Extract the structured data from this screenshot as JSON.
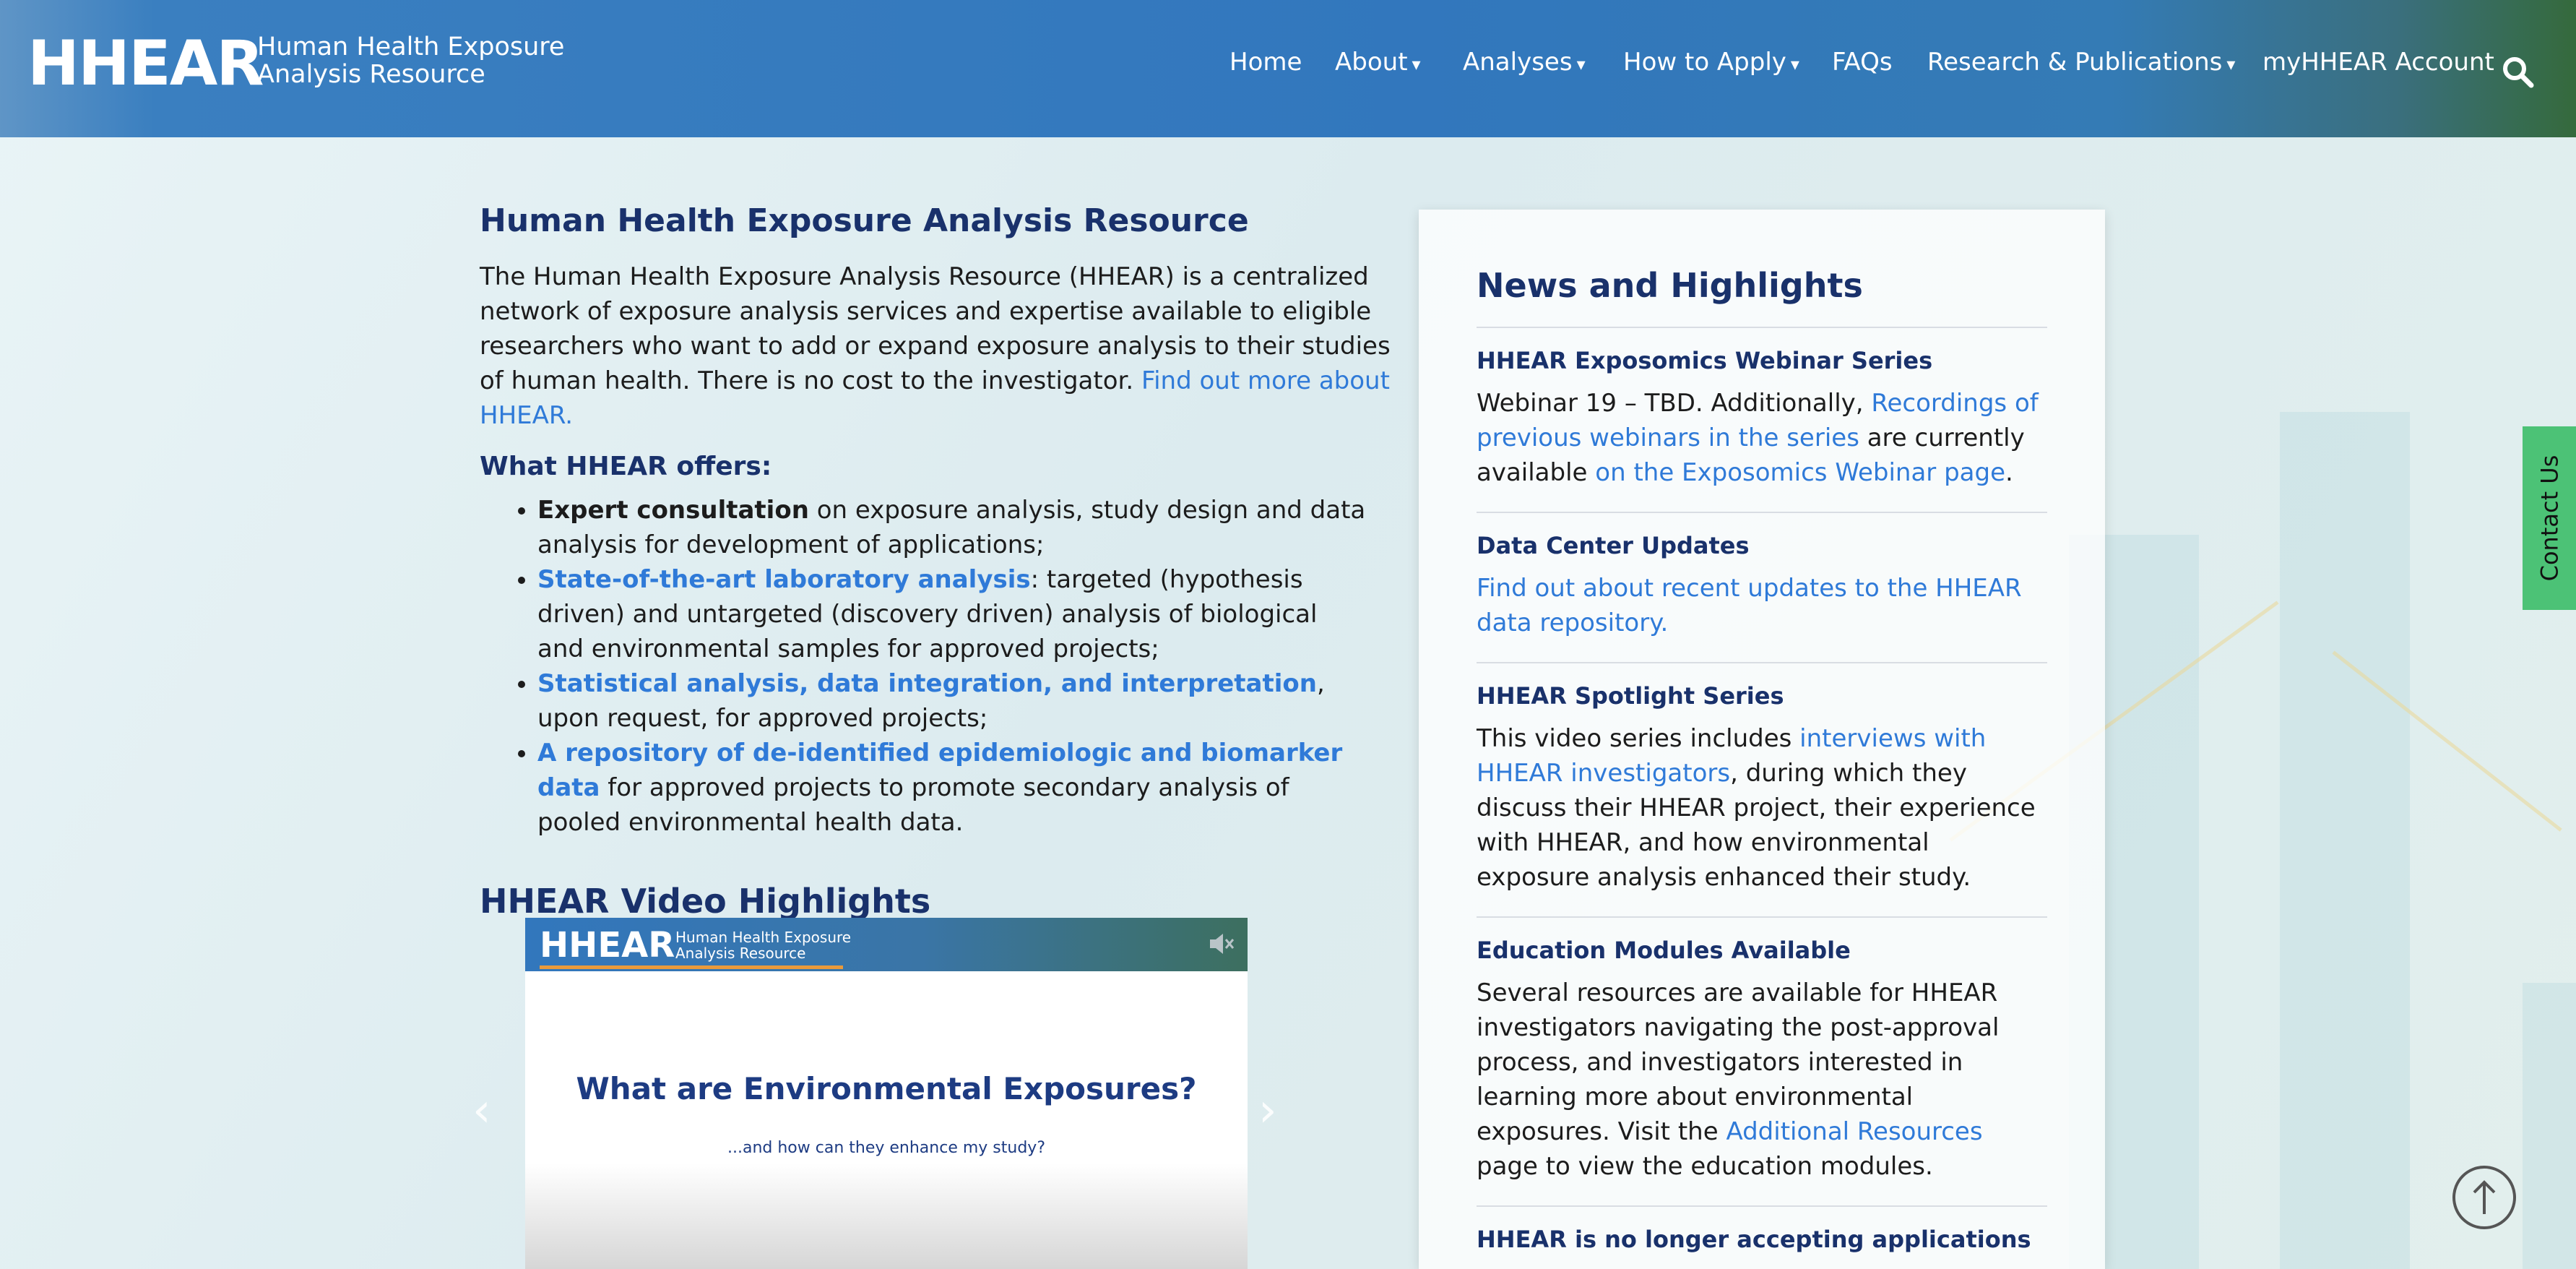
{
  "header": {
    "logo": "HHEAR",
    "logo_sub_line1": "Human Health Exposure",
    "logo_sub_line2": "Analysis Resource",
    "nav": [
      {
        "label": "Home",
        "dropdown": false
      },
      {
        "label": "About",
        "dropdown": true
      },
      {
        "label": "Analyses",
        "dropdown": true
      },
      {
        "label": "How to Apply",
        "dropdown": true
      },
      {
        "label": "FAQs",
        "dropdown": false
      },
      {
        "label": "Research & Publications",
        "dropdown": true
      },
      {
        "label": "myHHEAR Account",
        "dropdown": false
      }
    ],
    "search_icon": "search-icon"
  },
  "main": {
    "title": "Human Health Exposure Analysis Resource",
    "intro_text": "The Human Health Exposure Analysis Resource (HHEAR) is a centralized network of exposure analysis services and expertise available to eligible researchers who want to add or expand exposure analysis to their studies of human health. There is no cost to the investigator. ",
    "intro_link": "Find out more about HHEAR.",
    "offers_title": "What HHEAR offers:",
    "offers": [
      {
        "lead": "Expert consultation",
        "lead_is_link": false,
        "rest": " on exposure analysis, study design and data analysis for development of applications;"
      },
      {
        "lead": "State-of-the-art laboratory analysis",
        "lead_is_link": true,
        "rest": ": targeted (hypothesis driven) and untargeted (discovery driven) analysis of biological and environmental samples for approved projects;"
      },
      {
        "lead": "Statistical analysis, data integration, and interpretation",
        "lead_is_link": true,
        "rest": ", upon request, for approved projects;"
      },
      {
        "lead": "A repository of de-identified epidemiologic and biomarker data",
        "lead_is_link": true,
        "rest": " for approved projects to promote secondary analysis of pooled environmental health data."
      }
    ],
    "video_section_title": "HHEAR Video Highlights",
    "video": {
      "logo": "HHEAR",
      "logo_sub_line1": "Human Health Exposure",
      "logo_sub_line2": "Analysis Resource",
      "title": "What are Environmental Exposures?",
      "subtitle": "...and how can they enhance my study?",
      "prev_icon": "chevron-left-icon",
      "next_icon": "chevron-right-icon",
      "mute_icon": "speaker-muted-icon"
    }
  },
  "news": {
    "title": "News and Highlights",
    "items": [
      {
        "head": "HHEAR Exposomics Webinar Series",
        "t1": "Webinar 19 – TBD. Additionally, ",
        "l1": "Recordings of previous webinars in the series",
        "t2": " are currently available ",
        "l2": "on the Exposomics Webinar page",
        "t3": "."
      },
      {
        "head": "Data Center Updates",
        "t1": "",
        "l1": "Find out about recent updates to the HHEAR data repository.",
        "t2": "",
        "l2": "",
        "t3": ""
      },
      {
        "head": "HHEAR Spotlight Series",
        "t1": "This video series includes ",
        "l1": "interviews with HHEAR investigators",
        "t2": ", during which they discuss their HHEAR project, their experience with HHEAR, and how environmental exposure analysis enhanced their study.",
        "l2": "",
        "t3": ""
      },
      {
        "head": "Education Modules Available",
        "t1": "Several resources are available for HHEAR investigators navigating the post-approval process, and investigators interested in learning more about environmental exposures. Visit the ",
        "l1": "Additional Resources",
        "t2": " page to view the education modules.",
        "l2": "",
        "t3": ""
      },
      {
        "head": "HHEAR is no longer accepting applications",
        "t1": "",
        "l1": "",
        "t2": "",
        "l2": "",
        "t3": ""
      }
    ]
  },
  "contact_tab": "Contact Us",
  "back_to_top_icon": "arrow-up-circle-icon",
  "colors": {
    "header_blue": "#3277bd",
    "header_green": "#356a3c",
    "heading_navy": "#19316b",
    "link_blue": "#2f7ad8",
    "contact_green": "#4cc276"
  }
}
